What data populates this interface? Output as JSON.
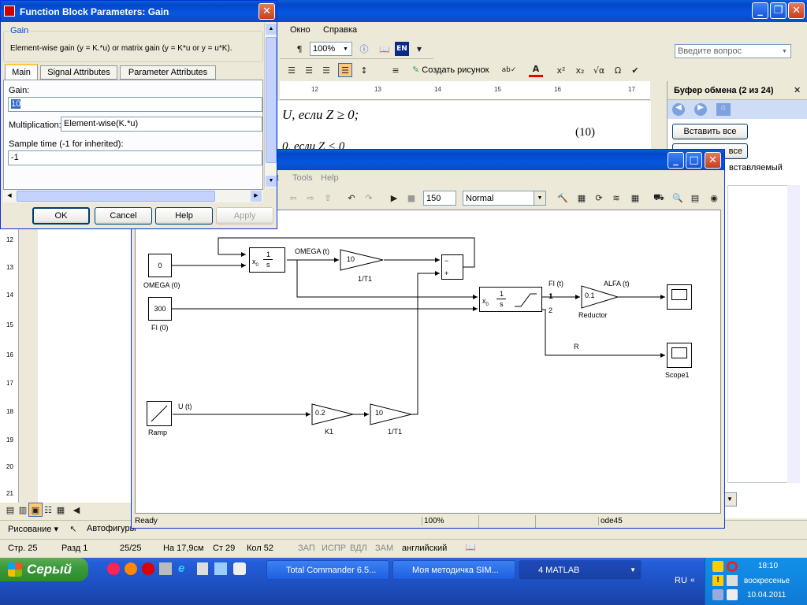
{
  "word": {
    "menu": {
      "window": "Окно",
      "help": "Справка"
    },
    "ask_placeholder": "Введите вопрос",
    "zoom": "100%",
    "lang": "EN",
    "create_drawing": "Создать рисунок",
    "doc_formula1": "U, если Z ≥ 0;",
    "doc_eqnum": "(10)",
    "doc_formula2": "0, если Z < 0",
    "ruler_marks": [
      "12",
      "13",
      "14",
      "15",
      "16",
      "17"
    ],
    "vruler_marks": [
      "12",
      "13",
      "14",
      "15",
      "16",
      "17",
      "18",
      "19",
      "20",
      "21"
    ],
    "clipboard": {
      "title": "Буфер обмена (2 из 24)",
      "paste_all": "Вставить все",
      "clear_all": "все",
      "item": "вставляемый"
    },
    "drawing_label": "Рисование ▾",
    "autoshapes": "Автофигуры",
    "status": {
      "page": "Стр. 25",
      "section": "Разд 1",
      "pages": "25/25",
      "at": "На 17,9см",
      "line": "Ст 29",
      "col": "Кол 52",
      "rec": "ЗАП",
      "trk": "ИСПР",
      "ext": "ВДЛ",
      "ovr": "ЗАМ",
      "lang": "английский"
    }
  },
  "dialog": {
    "title": "Function Block Parameters: Gain",
    "group": "Gain",
    "description": "Element-wise gain (y = K.*u) or matrix gain (y = K*u or y = u*K).",
    "tabs": [
      "Main",
      "Signal Attributes",
      "Parameter Attributes"
    ],
    "gain_label": "Gain:",
    "gain_value": "10",
    "mult_label": "Multiplication:",
    "mult_value": "Element-wise(K.*u)",
    "sample_label": "Sample time (-1 for inherited):",
    "sample_value": "-1",
    "buttons": {
      "ok": "OK",
      "cancel": "Cancel",
      "help": "Help",
      "apply": "Apply"
    }
  },
  "simulink": {
    "menu": {
      "tools": "Tools",
      "help": "Help",
      "t": "t"
    },
    "stop_time": "150",
    "sim_mode": "Normal",
    "status": {
      "ready": "Ready",
      "zoom": "100%",
      "solver": "ode45"
    },
    "blocks": {
      "omega0_val": "0",
      "omega0_lbl": "OMEGA (0)",
      "fi0_val": "300",
      "fi0_lbl": "FI (0)",
      "int1_num": "1",
      "int1_den": "s",
      "x0": "x",
      "omega_sig": "OMEGA (t)",
      "gain1_val": "10",
      "gain1_lbl": "1/T1",
      "sum_minus": "−",
      "sum_plus": "+",
      "int2_num": "1",
      "int2_den": "s",
      "port1": "1",
      "port2": "2",
      "fi_sig": "FI (t)",
      "alfa_sig": "ALFA (t)",
      "red_val": "0.1",
      "red_lbl": "Reductor",
      "r_sig": "R",
      "scope1_lbl": "Scope1",
      "ramp_lbl": "Ramp",
      "u_sig": "U (t)",
      "k1_val": "0.2",
      "k1_lbl": "K1",
      "gain2_val": "10",
      "gain2_lbl": "1/T1"
    }
  },
  "taskbar": {
    "start": "Серый",
    "tasks": [
      "Total Commander 6.5...",
      "Моя методичка SIM...",
      "4 MATLAB"
    ],
    "lang": "RU",
    "time": "18:10",
    "day": "воскресенье",
    "date": "10.04.2011"
  },
  "colors": {
    "xp_blue": "#0a5fd8",
    "taskbar": "#245edb",
    "start": "#3c9b3c"
  }
}
